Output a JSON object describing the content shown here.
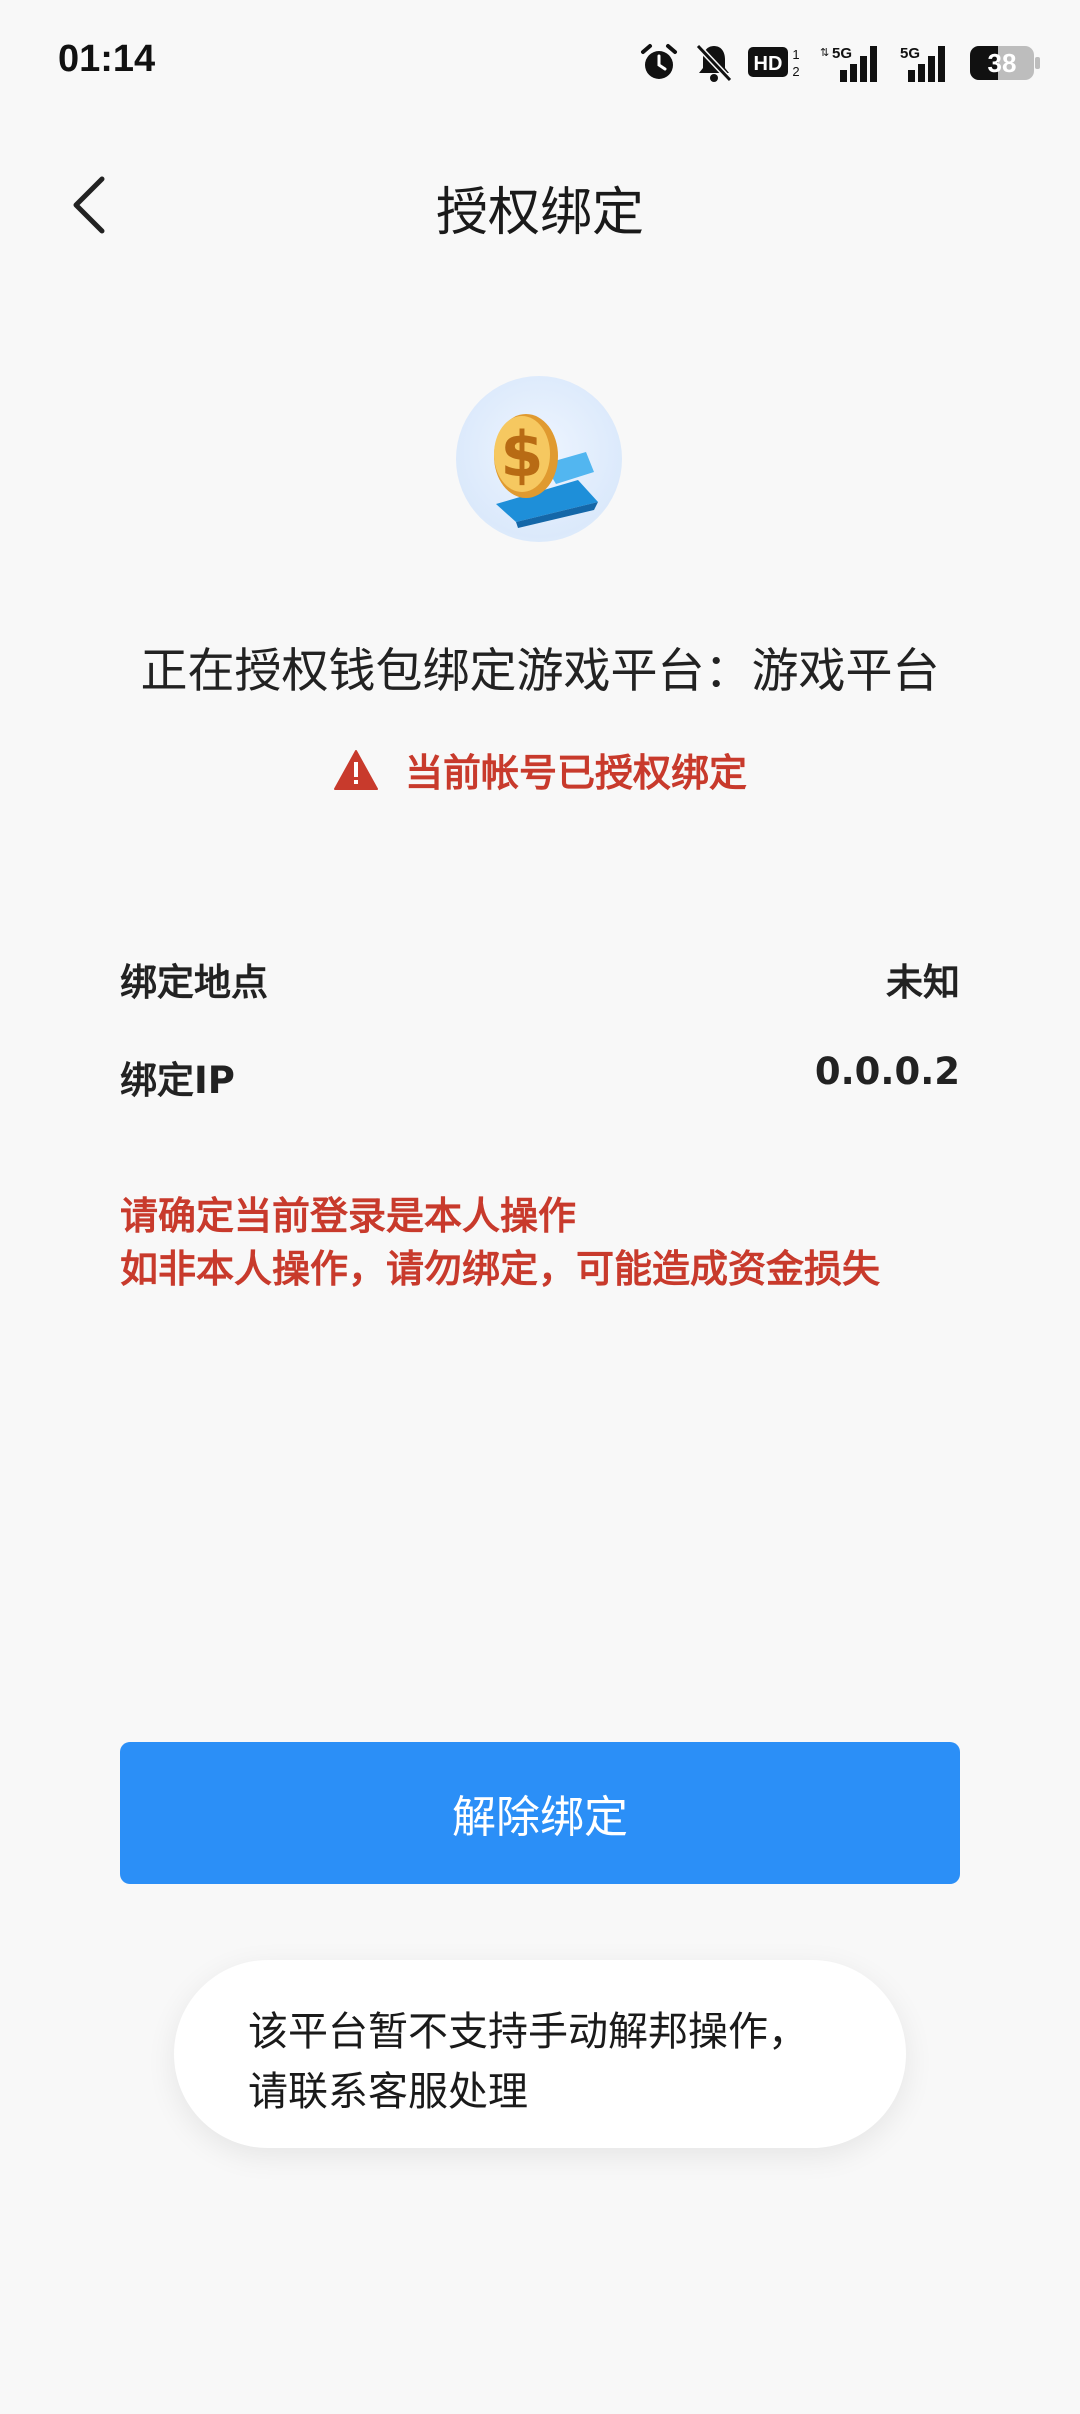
{
  "status_bar": {
    "time": "01:14",
    "battery_level": "38",
    "icons": [
      "alarm-icon",
      "notifications-muted-icon",
      "hd-icon",
      "signal-5g-icon",
      "signal-5g-icon",
      "battery-icon"
    ]
  },
  "header": {
    "title": "授权绑定",
    "back_icon": "chevron-left-icon"
  },
  "app": {
    "logo_icon": "dollar-coin-logo-icon"
  },
  "binding": {
    "message": "正在授权钱包绑定游戏平台：游戏平台",
    "warning_icon": "warning-triangle-icon",
    "warning": "当前帐号已授权绑定"
  },
  "details": [
    {
      "label": "绑定地点",
      "value": "未知"
    },
    {
      "label": "绑定IP",
      "value": "0.0.0.2"
    }
  ],
  "caution": {
    "line1": "请确定当前登录是本人操作",
    "line2": "如非本人操作，请勿绑定，可能造成资金损失"
  },
  "unbind_button": {
    "label": "解除绑定"
  },
  "toast": {
    "line1": "该平台暂不支持手动解邦操作，",
    "line2": "请联系客服处理"
  },
  "colors": {
    "accent": "#2b8ff7",
    "warning": "#c83a2c",
    "background": "#f8f8f8"
  }
}
